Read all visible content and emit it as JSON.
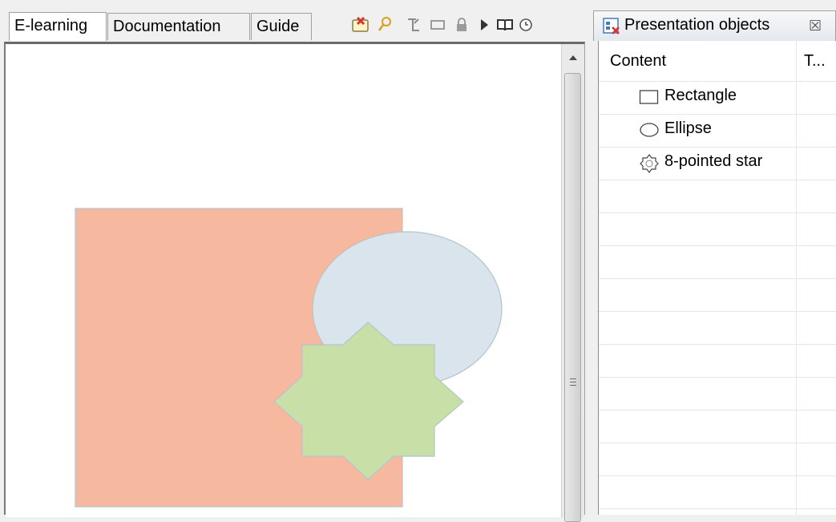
{
  "tabs": [
    {
      "label": "E-learning",
      "active": true
    },
    {
      "label": "Documentation",
      "active": false
    },
    {
      "label": "Guide",
      "active": false
    }
  ],
  "toolbar": {
    "icons": [
      "delete-object-icon",
      "zoom-icon",
      "export-icon",
      "rectangle-tool-icon",
      "lock-icon",
      "play-icon",
      "book-icon",
      "clock-icon"
    ]
  },
  "canvas": {
    "shapes": [
      {
        "kind": "rectangle",
        "fill": "#f7b8a0"
      },
      {
        "kind": "ellipse",
        "fill": "#dae4ec"
      },
      {
        "kind": "star",
        "fill": "#c8e0a8"
      }
    ]
  },
  "objects_panel": {
    "title": "Presentation objects",
    "close_glyph": "☒",
    "columns": [
      "Content",
      "T..."
    ],
    "items": [
      {
        "label": "Rectangle",
        "icon": "rectangle-icon"
      },
      {
        "label": "Ellipse",
        "icon": "ellipse-icon"
      },
      {
        "label": "8-pointed star",
        "icon": "eight-pointed-star-icon"
      }
    ],
    "empty_rows": 10
  },
  "colors": {
    "accent_red": "#d9342b",
    "shape_stroke": "#b4c4cc"
  }
}
